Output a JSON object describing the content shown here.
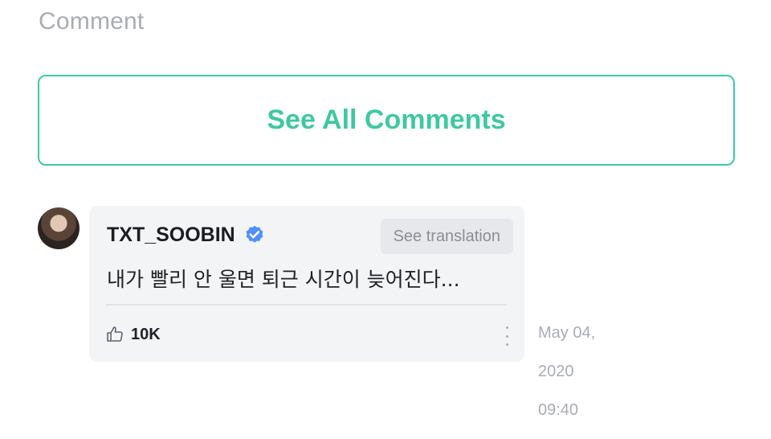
{
  "section": {
    "title": "Comment"
  },
  "see_all": {
    "label": "See All Comments"
  },
  "comment": {
    "author": "TXT_SOOBIN",
    "translate_label": "See translation",
    "text": "내가 빨리 안 울면 퇴근 시간이 늦어진다...",
    "likes": "10K",
    "date_line1": "May 04,",
    "date_line2": "2020",
    "date_line3": "09:40"
  },
  "colors": {
    "accent": "#3fc8a1",
    "verified": "#4f8ff7",
    "muted": "#a9acb2",
    "card_bg": "#f3f4f6"
  },
  "icons": [
    "verified-badge-icon",
    "thumbs-up-icon",
    "more-vertical-icon"
  ]
}
